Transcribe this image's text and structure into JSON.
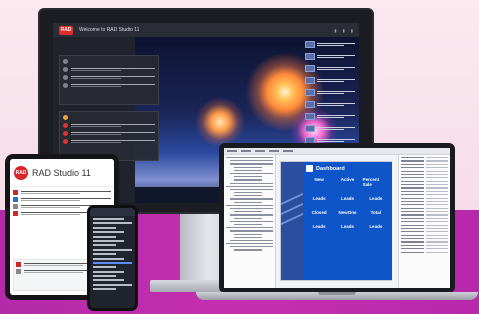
{
  "monitor": {
    "logo": "RAD",
    "title": "Welcome to RAD Studio 11"
  },
  "tablet": {
    "logo": "RAD",
    "title": "RAD Studio 11"
  },
  "laptop": {
    "dashboard": {
      "title": "Dashboard",
      "tiles": [
        {
          "label": "New"
        },
        {
          "label": "Active"
        },
        {
          "label": "Percent Sale"
        },
        {
          "label": "Leads"
        },
        {
          "label": "Leads"
        },
        {
          "label": "Leads"
        },
        {
          "label": "Closed"
        },
        {
          "label": "NewOne"
        },
        {
          "label": "Total"
        },
        {
          "label": "Leads"
        },
        {
          "label": "Leads"
        },
        {
          "label": "Leads"
        }
      ]
    }
  },
  "colors": {
    "accent_red": "#d9262a",
    "dashboard_blue": "#0d55c9",
    "magenta_band": "#c42fb0"
  }
}
